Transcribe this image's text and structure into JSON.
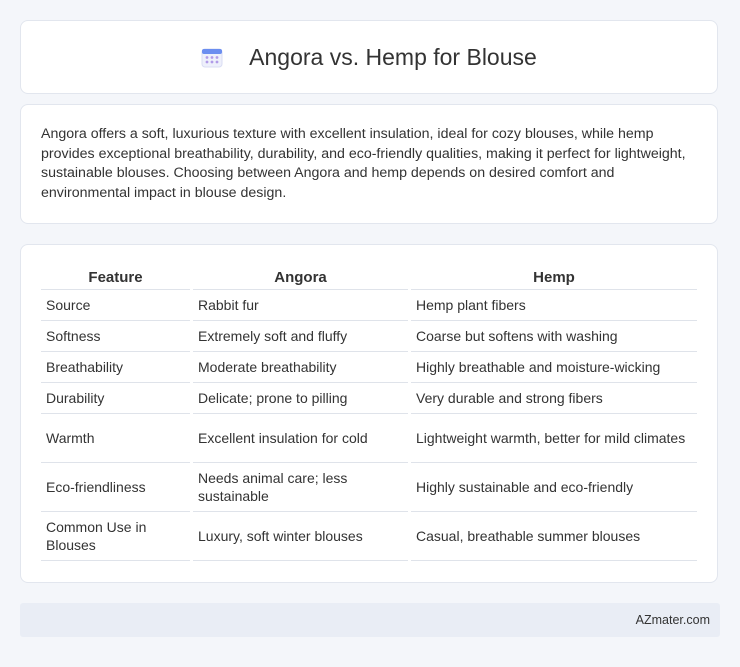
{
  "header": {
    "icon": "calendar-icon",
    "title": "Angora vs. Hemp for Blouse"
  },
  "intro": {
    "text": "Angora offers a soft, luxurious texture with excellent insulation, ideal for cozy blouses, while hemp provides exceptional breathability, durability, and eco-friendly qualities, making it perfect for lightweight, sustainable blouses. Choosing between Angora and hemp depends on desired comfort and environmental impact in blouse design."
  },
  "table": {
    "headers": [
      "Feature",
      "Angora",
      "Hemp"
    ],
    "rows": [
      {
        "feature": "Source",
        "angora": "Rabbit fur",
        "hemp": "Hemp plant fibers"
      },
      {
        "feature": "Softness",
        "angora": "Extremely soft and fluffy",
        "hemp": "Coarse but softens with washing"
      },
      {
        "feature": "Breathability",
        "angora": "Moderate breathability",
        "hemp": "Highly breathable and moisture-wicking"
      },
      {
        "feature": "Durability",
        "angora": "Delicate; prone to pilling",
        "hemp": "Very durable and strong fibers"
      },
      {
        "feature": "Warmth",
        "angora": "Excellent insulation for cold",
        "hemp": "Lightweight warmth, better for mild climates"
      },
      {
        "feature": "Eco-friendliness",
        "angora": "Needs animal care; less sustainable",
        "hemp": "Highly sustainable and eco-friendly"
      },
      {
        "feature": "Common Use in Blouses",
        "angora": "Luxury, soft winter blouses",
        "hemp": "Casual, breathable summer blouses"
      }
    ]
  },
  "footer": {
    "brand": "AZmater.com"
  },
  "colors": {
    "background": "#f4f6fa",
    "card": "#ffffff",
    "footer": "#e9edf5",
    "icon_top": "#6b8ef0",
    "icon_dots": "#b19be8"
  }
}
